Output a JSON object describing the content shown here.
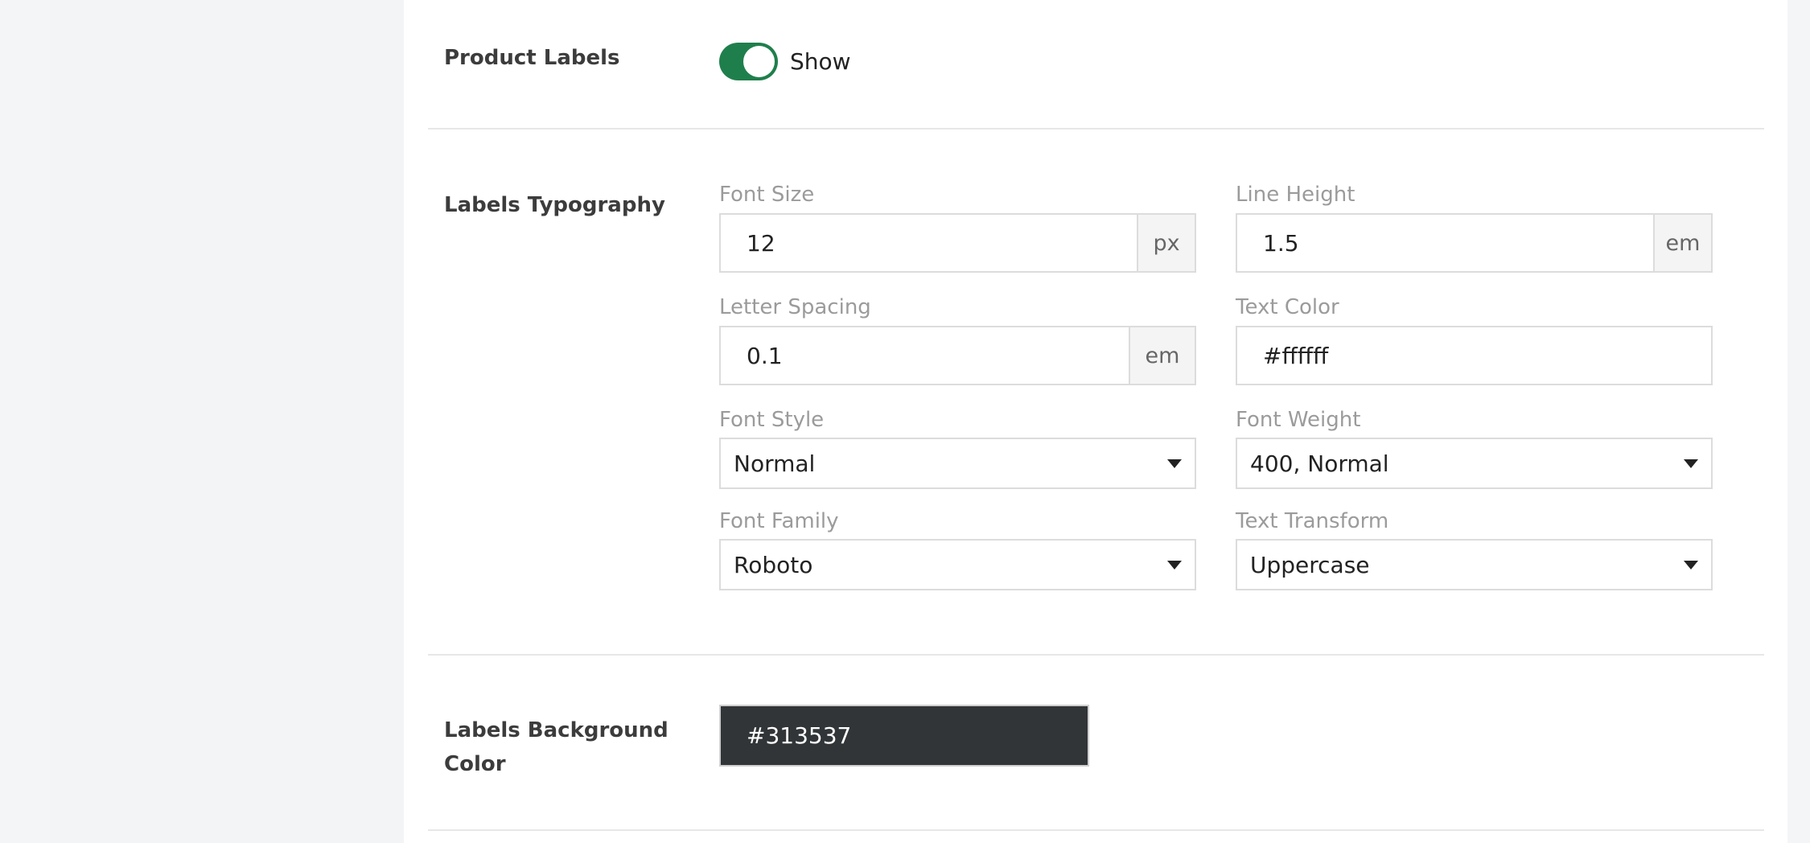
{
  "product_labels": {
    "label": "Product Labels",
    "toggle_text": "Show",
    "toggle_on": true
  },
  "typography": {
    "label": "Labels Typography",
    "font_size": {
      "label": "Font Size",
      "value": "12",
      "unit": "px"
    },
    "line_height": {
      "label": "Line Height",
      "value": "1.5",
      "unit": "em"
    },
    "letter_spacing": {
      "label": "Letter Spacing",
      "value": "0.1",
      "unit": "em"
    },
    "text_color": {
      "label": "Text Color",
      "value": "#ffffff"
    },
    "font_style": {
      "label": "Font Style",
      "value": "Normal"
    },
    "font_weight": {
      "label": "Font Weight",
      "value": "400, Normal"
    },
    "font_family": {
      "label": "Font Family",
      "value": "Roboto"
    },
    "text_transform": {
      "label": "Text Transform",
      "value": "Uppercase"
    }
  },
  "background": {
    "label_line1": "Labels Background",
    "label_line2": "Color",
    "value": "#313537"
  },
  "colors": {
    "toggle_on": "#1f7f4c",
    "background_swatch": "#313537"
  }
}
